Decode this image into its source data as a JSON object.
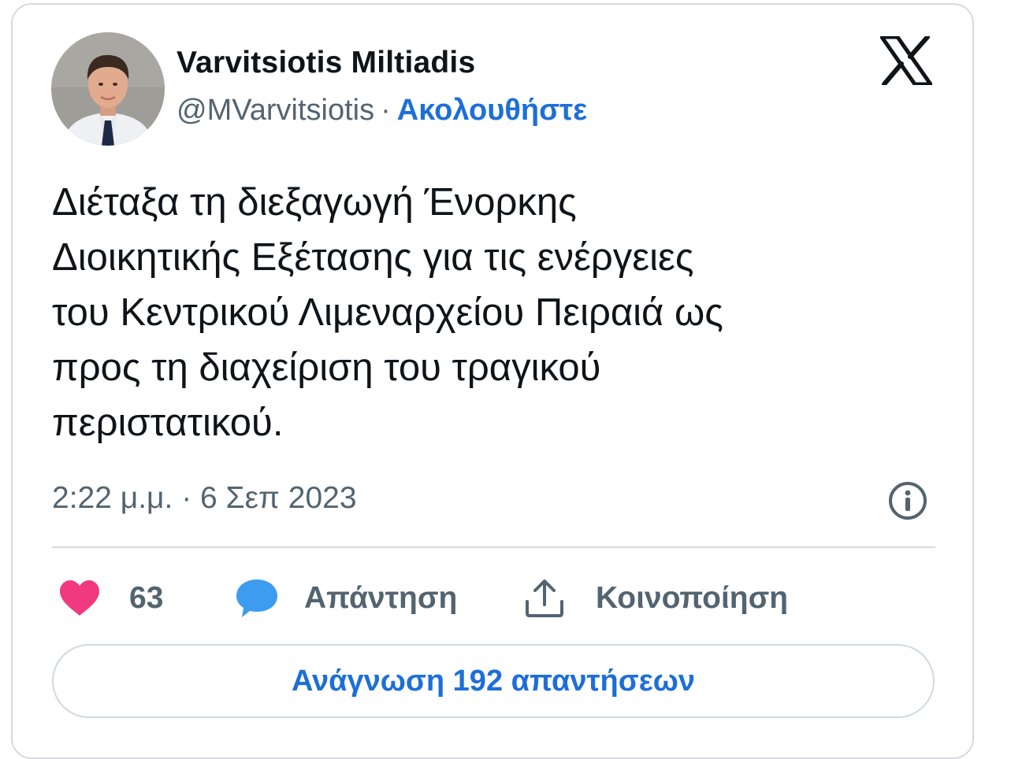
{
  "author": {
    "name": "Varvitsiotis Miltiadis",
    "handle": "@MVarvitsiotis",
    "separator": "·",
    "follow_label": "Ακολουθήστε"
  },
  "brand_logo": "x-logo-icon",
  "tweet": {
    "text": "Διέταξα τη διεξαγωγή Ένορκης\nΔιοικητικής Εξέτασης για τις ενέργειες\nτου Κεντρικού Λιμεναρχείου Πειραιά ως\nπρος τη διαχείριση του τραγικού\nπεριστατικού.",
    "timestamp": "2:22 μ.μ. · 6 Σεπ 2023"
  },
  "actions": {
    "like_count": "63",
    "reply_label": "Απάντηση",
    "share_label": "Κοινοποίηση"
  },
  "read_replies_label": "Ανάγνωση 192 απαντήσεων",
  "colors": {
    "accent": "#1d6fd8",
    "heart": "#f0397f",
    "reply_bubble": "#3d9cf0",
    "text_primary": "#0f1419",
    "text_secondary": "#536471",
    "border": "#d6dade"
  }
}
